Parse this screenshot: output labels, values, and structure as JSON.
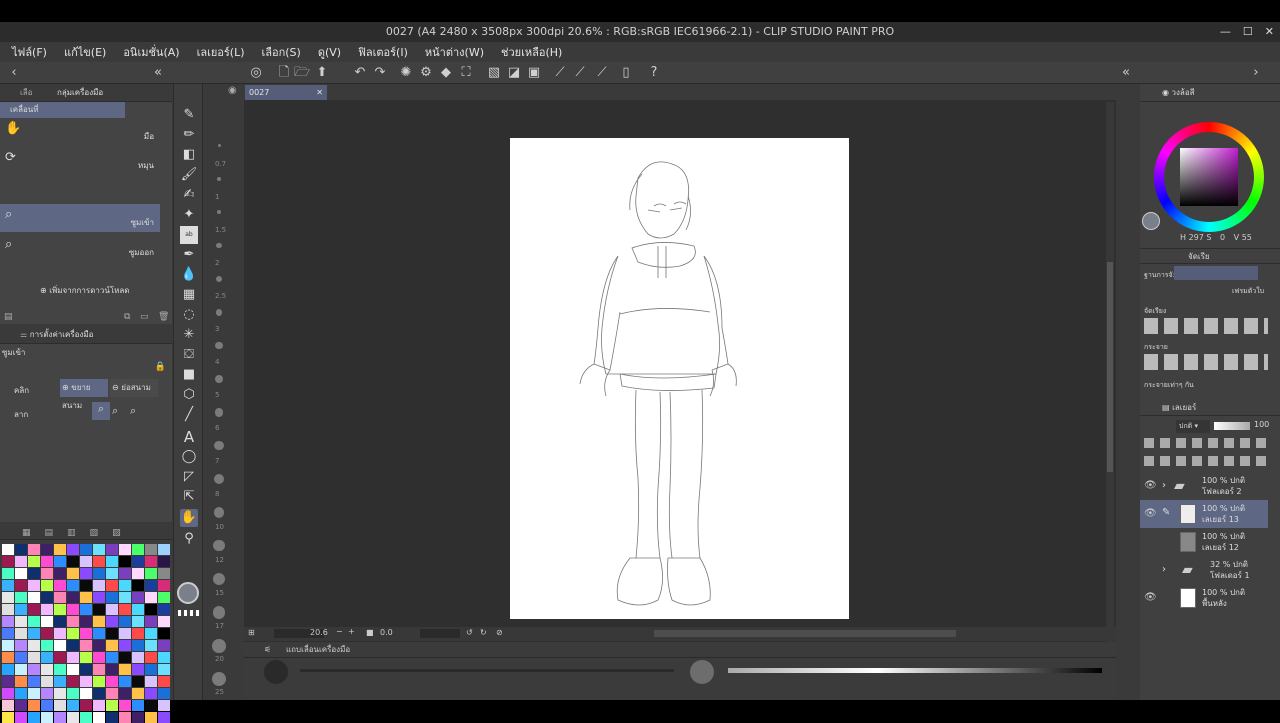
{
  "window": {
    "title": "0027 (A4 2480 x 3508px 300dpi 20.6% : RGB:sRGB IEC61966-2.1)  - CLIP STUDIO PAINT PRO",
    "min": "—",
    "max": "☐",
    "close": "✕"
  },
  "menu": [
    "ไฟล์(F)",
    "แก้ไข(E)",
    "อนิเมชั่น(A)",
    "เลเยอร์(L)",
    "เลือก(S)",
    "ดู(V)",
    "ฟิลเตอร์(I)",
    "หน้าต่าง(W)",
    "ช่วยเหลือ(H)"
  ],
  "left_panel": {
    "tabs": [
      "เลือ",
      "กลุ่มเครื่องมือ"
    ],
    "group_title": "เคลื่อนที่",
    "subtools": [
      {
        "label": "มือ",
        "icon": "hand-icon",
        "selected": false
      },
      {
        "label": "หมุน",
        "icon": "rotate-icon",
        "selected": false
      },
      {
        "label": "ซูมเข้า",
        "icon": "zoom-in-icon",
        "selected": true
      },
      {
        "label": "ซูมออก",
        "icon": "zoom-out-icon",
        "selected": false
      }
    ],
    "add_download": "เพิ่มจากการดาวน์โหลด",
    "tool_property_tab": "การตั้งค่าเครื่องมือ",
    "tool_property_title": "ซูมเข้า",
    "click_label": "คลิก",
    "zoom_in_option": "ขยายสนาม",
    "zoom_out_option": "ย่อสนาม",
    "drag_label": "ลาก"
  },
  "document": {
    "tab_name": "0027",
    "zoom": "20.6",
    "angle": "0.0"
  },
  "brush_bar_title": "แถบเลื่อนเครื่องมือ",
  "ruler_ticks": [
    "0.7",
    "1",
    "1.5",
    "2",
    "2.5",
    "3",
    "4",
    "5",
    "6",
    "7",
    "8",
    "10",
    "12",
    "15",
    "17",
    "20",
    "25"
  ],
  "right_panel": {
    "color_tab": "วงล้อสี",
    "color_values": {
      "h": "297",
      "s": "0",
      "v": "55"
    },
    "color_label_h": "H",
    "color_label_s": "S",
    "color_label_v": "V",
    "align_tab": "จัดเรีย",
    "align_target": "ฐานการจั:",
    "align_target_value": "เฟรมตัวใบ",
    "align_label": "จัดเรียง",
    "distribute_label": "กระจาย",
    "equal_label": "กระจายเท่าๆ กัน",
    "layer_tab": "เลเยอร์",
    "blend_mode": "ปกติ",
    "opacity": "100",
    "layers": [
      {
        "pct": "100 % ปกติ",
        "name": "โฟลเดอร์ 2",
        "type": "folder",
        "visible": true,
        "selected": false
      },
      {
        "pct": "100 % ปกติ",
        "name": "เลเยอร์ 13",
        "type": "raster",
        "visible": true,
        "selected": true
      },
      {
        "pct": "100 % ปกติ",
        "name": "เลเยอร์ 12",
        "type": "raster",
        "visible": false,
        "selected": false
      },
      {
        "pct": "32 % ปกติ",
        "name": "โฟลเดอร์ 1",
        "type": "folder",
        "visible": false,
        "selected": false
      },
      {
        "pct": "100 % ปกติ",
        "name": "พื้นหลัง",
        "type": "paper",
        "visible": true,
        "selected": false
      }
    ]
  },
  "colors": {
    "accent": "#5e6784",
    "bg": "#3a3a3a",
    "canvas_bg": "#2f2f2f"
  },
  "icons": {
    "hand": "✋",
    "rotate": "⟳",
    "zoom": "🔍",
    "plus": "⊕",
    "eye": "👁",
    "folder": "▰",
    "pen": "✎"
  }
}
